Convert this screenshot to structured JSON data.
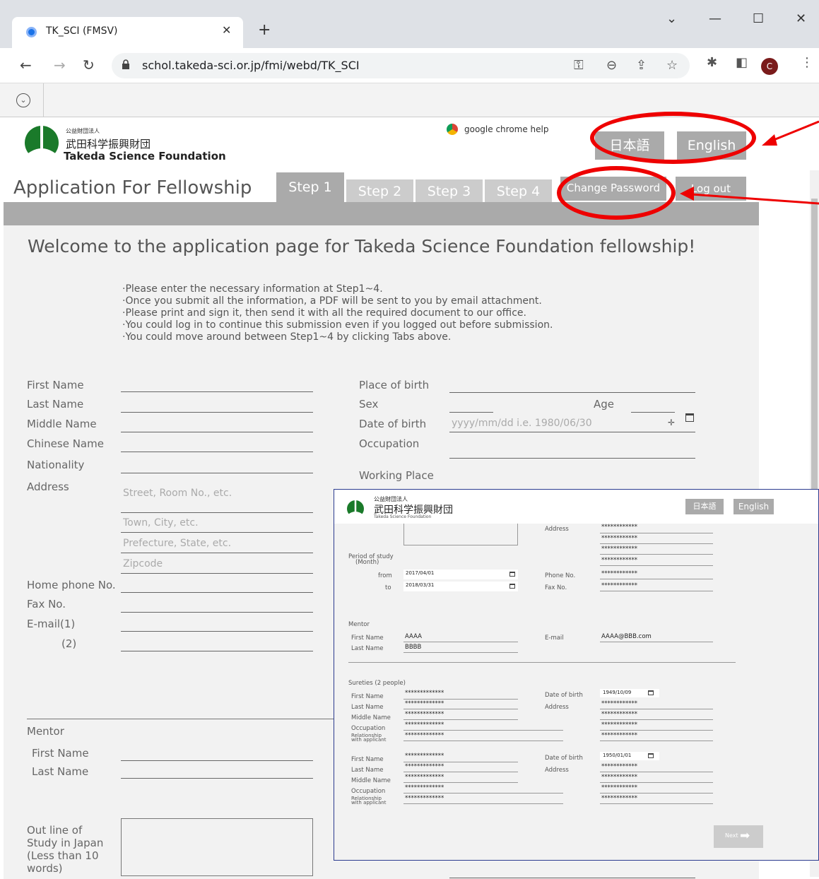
{
  "browser": {
    "tab_title": "TK_SCI (FMSV)",
    "url": "schol.takeda-sci.or.jp/fmi/webd/TK_SCI",
    "profile_initial": "C"
  },
  "header": {
    "org_small": "公益財団法人",
    "org_jp": "武田科学振興財団",
    "org_en": "Takeda Science Foundation",
    "chrome_help": "google chrome help",
    "lang_jp": "日本語",
    "lang_en": "English",
    "app_title": "Application For Fellowship",
    "tabs": [
      "Step 1",
      "Step 2",
      "Step 3",
      "Step 4"
    ],
    "change_password": "Change Password",
    "logout": "Log out"
  },
  "welcome": "Welcome to the application page for Takeda Science Foundation fellowship!",
  "instructions": [
    "·Please enter the necessary information at Step1~4.",
    "·Once you submit all the information, a PDF will be sent to you by email attachment.",
    "·Please print and sign it, then send it with all the required document to our office.",
    "·You could log in to continue this submission even if you logged out before submission.",
    "·You could move around between Step1~4 by clicking Tabs above."
  ],
  "form": {
    "first_name": "First Name",
    "last_name": "Last Name",
    "middle_name": "Middle Name",
    "chinese_name": "Chinese Name",
    "nationality": "Nationality",
    "address": "Address",
    "addr_ph1": "Street, Room No., etc.",
    "addr_ph2": "Town, City, etc.",
    "addr_ph3": "Prefecture, State, etc.",
    "addr_ph4": "Zipcode",
    "home_phone": "Home phone No.",
    "fax": "Fax No.",
    "email1": "E-mail(1)",
    "email2": "(2)",
    "place_of_birth": "Place of birth",
    "sex": "Sex",
    "age": "Age",
    "dob": "Date of birth",
    "dob_ph": "yyyy/mm/dd i.e. 1980/06/30",
    "occupation": "Occupation",
    "working_place": "Working Place",
    "mentor": "Mentor",
    "mentor_first": "First Name",
    "mentor_last": "Last Name",
    "outline": "Out line of Study in Japan (Less than 10 words)"
  },
  "inset": {
    "org_small": "公益財団法人",
    "org_jp": "武田科学振興財団",
    "org_en": "Takeda Science Foundation",
    "lang_jp": "日本語",
    "lang_en": "English",
    "address": "Address",
    "mask": "************",
    "mask13": "*************",
    "period_of_study": "Period of study",
    "month": "(Month)",
    "from": "from",
    "to": "to",
    "from_val": "2017/04/01",
    "to_val": "2018/03/31",
    "phone": "Phone No.",
    "fax": "Fax No.",
    "mentor": "Mentor",
    "first_name": "First Name",
    "last_name": "Last Name",
    "mentor_first": "AAAA",
    "mentor_last": "BBBB",
    "email": "E-mail",
    "email_val": "AAAA@BBB.com",
    "sureties": "Sureties (2 people)",
    "middle_name": "Middle Name",
    "occupation": "Occupation",
    "relationship": "Relationship",
    "with_applicant": "with applicant",
    "dob": "Date of birth",
    "dob1": "1949/10/09",
    "dob2": "1950/01/01",
    "next": "Next"
  }
}
